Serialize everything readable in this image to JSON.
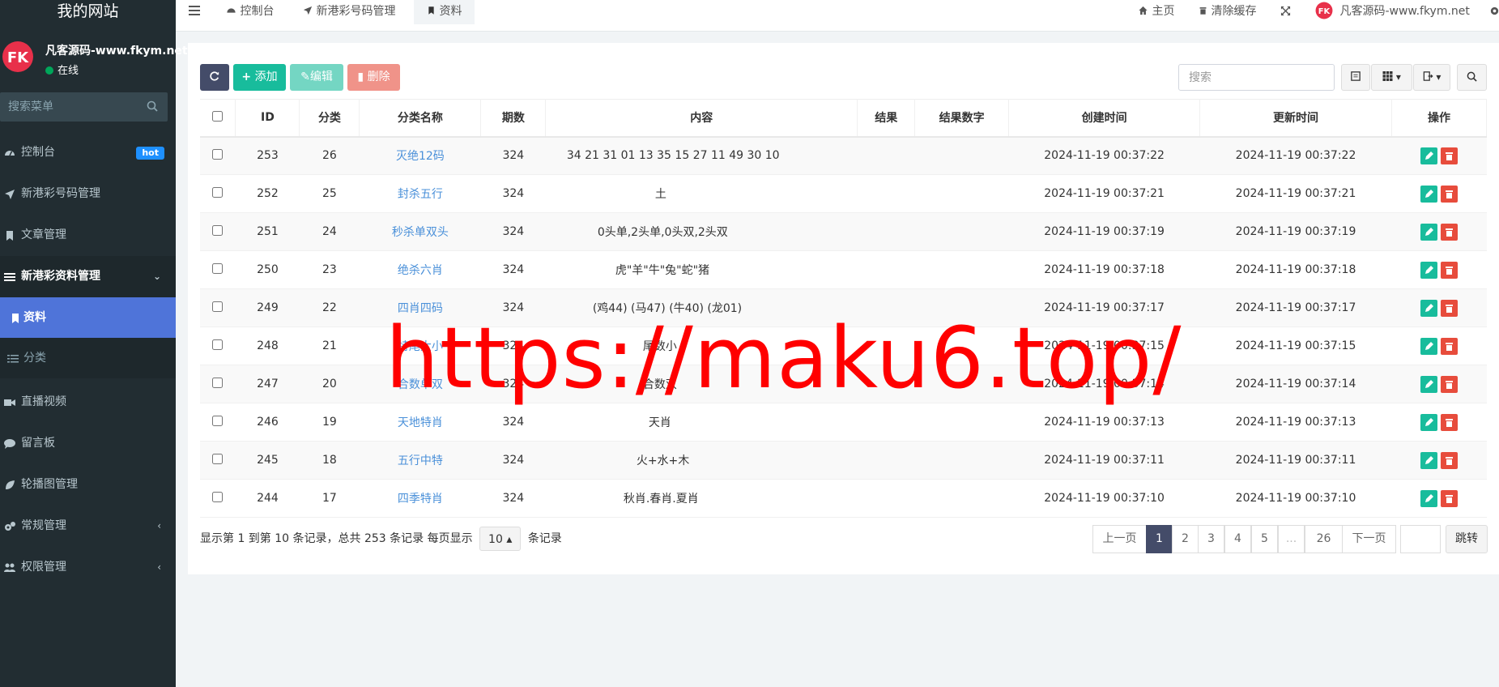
{
  "sidebar": {
    "brand": "我的网站",
    "user_name": "凡客源码-www.fkym.net",
    "user_status": "在线",
    "search_placeholder": "搜索菜单",
    "items": [
      {
        "label": "控制台",
        "icon": "dashboard-icon",
        "badge": "hot"
      },
      {
        "label": "新港彩号码管理",
        "icon": "paper-plane-icon"
      },
      {
        "label": "文章管理",
        "icon": "bookmark-icon"
      },
      {
        "label": "新港彩资料管理",
        "icon": "list-icon",
        "caret": "⌄"
      },
      {
        "label": "资料",
        "icon": "bookmark-icon"
      },
      {
        "label": "分类",
        "icon": "list-icon"
      },
      {
        "label": "直播视频",
        "icon": "video-icon"
      },
      {
        "label": "留言板",
        "icon": "comment-icon"
      },
      {
        "label": "轮播图管理",
        "icon": "leaf-icon"
      },
      {
        "label": "常规管理",
        "icon": "cogs-icon",
        "caret": "‹"
      },
      {
        "label": "权限管理",
        "icon": "group-icon",
        "caret": "‹"
      }
    ]
  },
  "topnav": {
    "tabs": [
      {
        "label": "控制台",
        "icon": "dashboard-icon"
      },
      {
        "label": "新港彩号码管理",
        "icon": "paper-plane-icon"
      },
      {
        "label": "资料",
        "icon": "bookmark-icon"
      }
    ],
    "home": "主页",
    "clear_cache": "清除缓存",
    "site_user": "凡客源码-www.fkym.net"
  },
  "toolbar": {
    "add": "添加",
    "edit": "编辑",
    "delete": "删除",
    "search_placeholder": "搜索"
  },
  "table": {
    "columns": [
      "ID",
      "分类",
      "分类名称",
      "期数",
      "内容",
      "结果",
      "结果数字",
      "创建时间",
      "更新时间",
      "操作"
    ],
    "rows": [
      {
        "id": "253",
        "cat": "26",
        "name": "灭绝12码",
        "period": "324",
        "content": "34 21 31 01 13 35 15 27 11 49 30 10",
        "result": "",
        "result_num": "",
        "created": "2024-11-19 00:37:22",
        "updated": "2024-11-19 00:37:22"
      },
      {
        "id": "252",
        "cat": "25",
        "name": "封杀五行",
        "period": "324",
        "content": "土",
        "result": "",
        "result_num": "",
        "created": "2024-11-19 00:37:21",
        "updated": "2024-11-19 00:37:21"
      },
      {
        "id": "251",
        "cat": "24",
        "name": "秒杀单双头",
        "period": "324",
        "content": "0头单,2头单,0头双,2头双",
        "result": "",
        "result_num": "",
        "created": "2024-11-19 00:37:19",
        "updated": "2024-11-19 00:37:19"
      },
      {
        "id": "250",
        "cat": "23",
        "name": "绝杀六肖",
        "period": "324",
        "content": "虎\"羊\"牛\"兔\"蛇\"猪",
        "result": "",
        "result_num": "",
        "created": "2024-11-19 00:37:18",
        "updated": "2024-11-19 00:37:18"
      },
      {
        "id": "249",
        "cat": "22",
        "name": "四肖四码",
        "period": "324",
        "content": "(鸡44) (马47) (牛40) (龙01)",
        "result": "",
        "result_num": "",
        "created": "2024-11-19 00:37:17",
        "updated": "2024-11-19 00:37:17"
      },
      {
        "id": "248",
        "cat": "21",
        "name": "特尾大小",
        "period": "324",
        "content": "尾数小",
        "result": "",
        "result_num": "",
        "created": "2024-11-19 00:37:15",
        "updated": "2024-11-19 00:37:15"
      },
      {
        "id": "247",
        "cat": "20",
        "name": "合数单双",
        "period": "324",
        "content": "合数双",
        "result": "",
        "result_num": "",
        "created": "2024-11-19 00:37:14",
        "updated": "2024-11-19 00:37:14"
      },
      {
        "id": "246",
        "cat": "19",
        "name": "天地特肖",
        "period": "324",
        "content": "天肖",
        "result": "",
        "result_num": "",
        "created": "2024-11-19 00:37:13",
        "updated": "2024-11-19 00:37:13"
      },
      {
        "id": "245",
        "cat": "18",
        "name": "五行中特",
        "period": "324",
        "content": "火+水+木",
        "result": "",
        "result_num": "",
        "created": "2024-11-19 00:37:11",
        "updated": "2024-11-19 00:37:11"
      },
      {
        "id": "244",
        "cat": "17",
        "name": "四季特肖",
        "period": "324",
        "content": "秋肖.春肖.夏肖",
        "result": "",
        "result_num": "",
        "created": "2024-11-19 00:37:10",
        "updated": "2024-11-19 00:37:10"
      }
    ]
  },
  "pagination": {
    "info_prefix": "显示第 1 到第 10 条记录，总共 253 条记录 每页显示",
    "per_page": "10",
    "info_suffix": "条记录",
    "prev": "上一页",
    "pages": [
      "1",
      "2",
      "3",
      "4",
      "5",
      "...",
      "26"
    ],
    "next": "下一页",
    "jump": "跳转"
  },
  "watermark": "https://maku6.top/",
  "colors": {
    "sidebar_bg": "#222d32",
    "active_menu": "#4f74d9",
    "success": "#18bc9c",
    "danger": "#e74c3c",
    "link": "#4a90d9"
  }
}
